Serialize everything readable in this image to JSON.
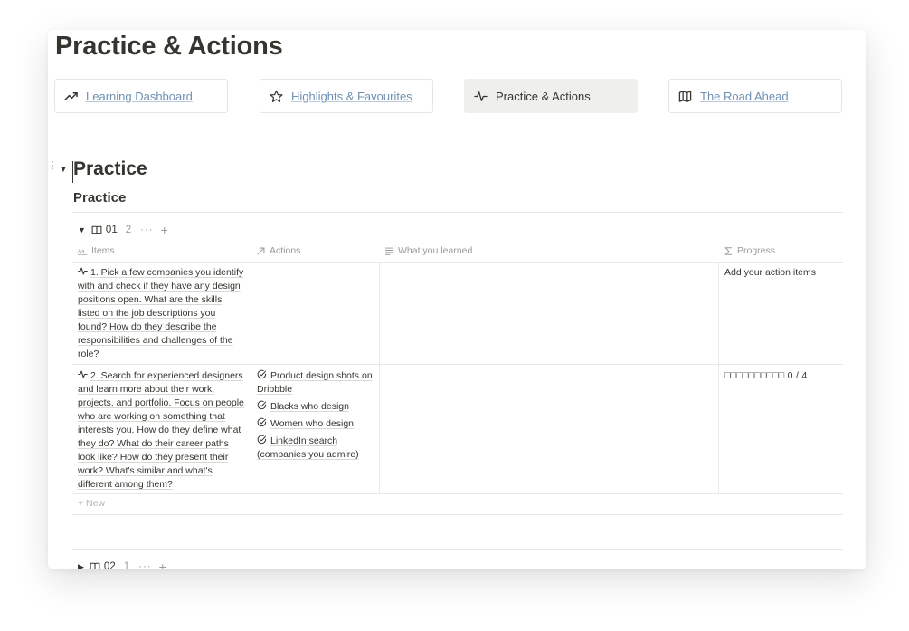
{
  "page": {
    "title": "Practice & Actions"
  },
  "nav": [
    {
      "label": "Learning Dashboard",
      "icon": "trending-up-icon"
    },
    {
      "label": "Highlights & Favourites",
      "icon": "star-icon"
    },
    {
      "label": "Practice & Actions",
      "icon": "activity-icon",
      "active": true
    },
    {
      "label": "The Road Ahead",
      "icon": "map-icon"
    }
  ],
  "section": {
    "heading": "Practice",
    "view_title": "Practice"
  },
  "groups": [
    {
      "name": "01",
      "count": "2",
      "more": "···",
      "plus": "+",
      "expanded": true
    },
    {
      "name": "02",
      "count": "1",
      "more": "···",
      "plus": "+",
      "expanded": false
    }
  ],
  "table": {
    "columns": [
      {
        "label": "Items",
        "icon": "text-property-icon"
      },
      {
        "label": "Actions",
        "icon": "relation-arrow-icon"
      },
      {
        "label": "What you learned",
        "icon": "text-lines-icon"
      },
      {
        "label": "Progress",
        "icon": "sigma-icon"
      }
    ],
    "rows": [
      {
        "item": "1. Pick a few companies you identify with and check if they have any design positions open. What are the skills listed on the job descriptions you found? How do they describe the responsibilities and challenges of the role?",
        "actions": [],
        "learned": "",
        "progress": "Add your action items"
      },
      {
        "item": "2. Search for experienced designers and learn more about their work, projects, and portfolio. Focus on people who are working on something that interests you. How do they define what they do? What do their career paths look like? How do they present their work? What's similar and what's different among them?",
        "actions": [
          "Product design shots on Dribbble",
          "Blacks who design",
          "Women who design",
          "LinkedIn search (companies you admire)"
        ],
        "learned": "",
        "progress": "□□□□□□□□□□ 0 / 4"
      }
    ],
    "new_label": "+ New"
  },
  "colors": {
    "link": "#6f8fb3",
    "text": "#37352f",
    "muted": "#9b9a97",
    "border": "#e9e9e7",
    "active_bg": "#efefed"
  }
}
